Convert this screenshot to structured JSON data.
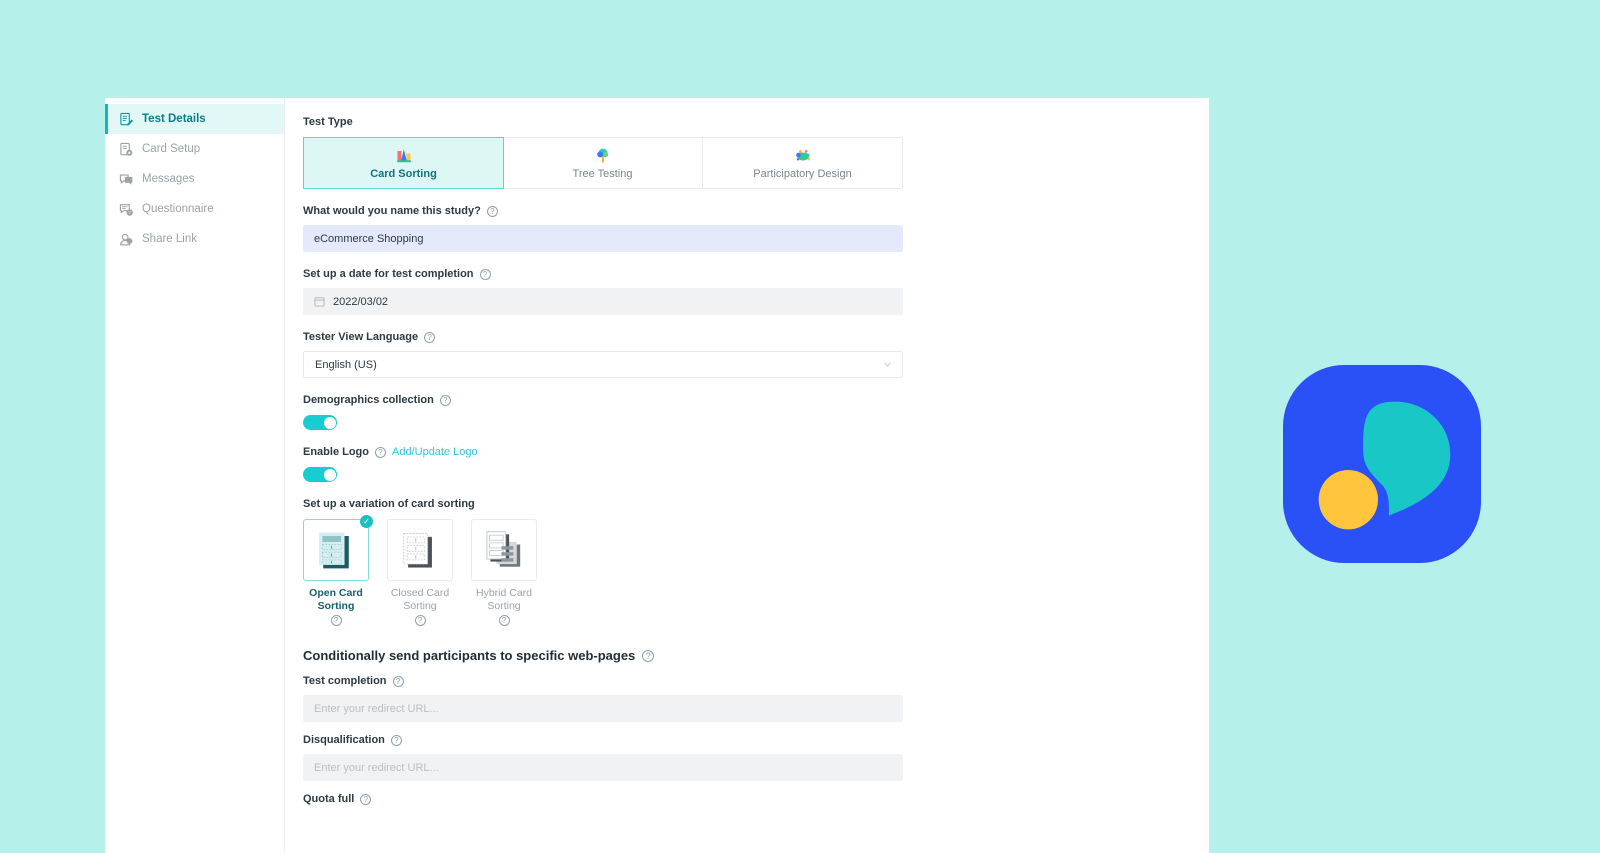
{
  "colors": {
    "page_background": "#b5f0ea",
    "accent_teal": "#1db5bd",
    "toggle_on": "#16cdd1",
    "link": "#2ec5d8",
    "selected_tab_bg": "#dcf7f4",
    "focused_input_bg": "#e4eafb",
    "brand_blue": "#2a50f8",
    "brand_teal": "#19c7c7",
    "brand_yellow": "#ffc63d"
  },
  "sidebar": {
    "items": [
      {
        "label": "Test Details",
        "icon": "document-edit-icon",
        "active": true
      },
      {
        "label": "Card Setup",
        "icon": "card-gear-icon",
        "active": false
      },
      {
        "label": "Messages",
        "icon": "chat-bubbles-icon",
        "active": false
      },
      {
        "label": "Questionnaire",
        "icon": "chat-question-icon",
        "active": false
      },
      {
        "label": "Share Link",
        "icon": "user-share-icon",
        "active": false
      }
    ]
  },
  "form": {
    "test_type": {
      "label": "Test Type",
      "options": [
        {
          "label": "Card Sorting",
          "icon": "bar-chart-colorful-icon",
          "selected": true
        },
        {
          "label": "Tree Testing",
          "icon": "tree-colorful-icon",
          "selected": false
        },
        {
          "label": "Participatory Design",
          "icon": "nodes-colorful-icon",
          "selected": false
        }
      ]
    },
    "study_name": {
      "label": "What would you name this study?",
      "value": "eCommerce Shopping"
    },
    "completion_date": {
      "label": "Set up a date for test completion",
      "value": "2022/03/02",
      "icon": "calendar-icon"
    },
    "language": {
      "label": "Tester View Language",
      "value": "English (US)",
      "icon": "chevron-down-icon"
    },
    "demographics": {
      "label": "Demographics collection",
      "enabled": true
    },
    "enable_logo": {
      "label": "Enable Logo",
      "link_label": "Add/Update Logo",
      "enabled": true
    },
    "variation": {
      "label": "Set up a variation of card sorting",
      "options": [
        {
          "label": "Open Card Sorting",
          "line1": "Open Card",
          "line2": "Sorting",
          "selected": true
        },
        {
          "label": "Closed Card Sorting",
          "line1": "Closed Card",
          "line2": "Sorting",
          "selected": false
        },
        {
          "label": "Hybrid Card Sorting",
          "line1": "Hybrid Card",
          "line2": "Sorting",
          "selected": false
        }
      ]
    },
    "redirects": {
      "title": "Conditionally send participants to specific web-pages",
      "test_completion": {
        "label": "Test completion",
        "placeholder": "Enter your redirect URL..."
      },
      "disqualification": {
        "label": "Disqualification",
        "placeholder": "Enter your redirect URL..."
      },
      "quota_full": {
        "label": "Quota full"
      }
    }
  },
  "brand_logo": {
    "name": "app-brand-logo"
  }
}
